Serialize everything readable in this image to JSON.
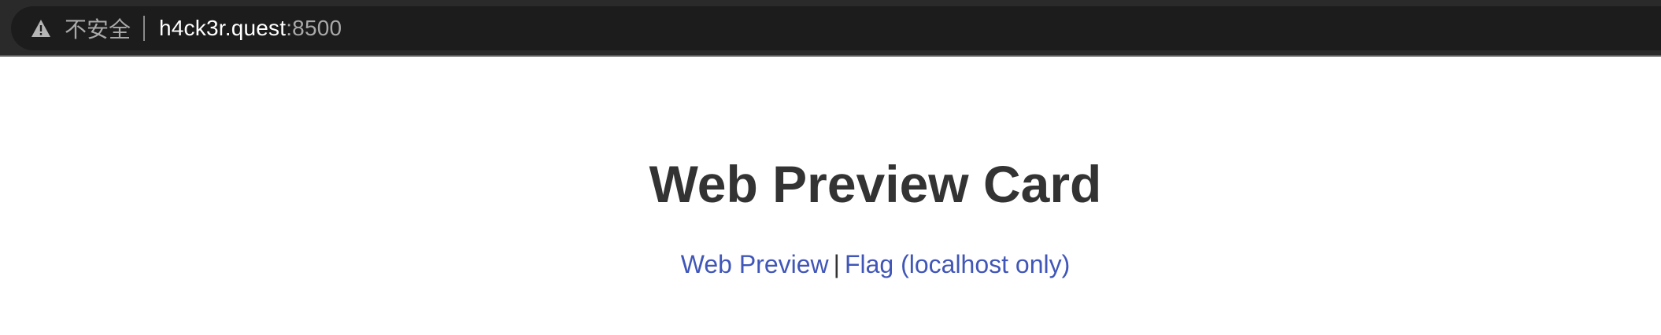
{
  "browser": {
    "security_label": "不安全",
    "url_host": "h4ck3r.quest",
    "url_port": ":8500",
    "warning_icon": "warning-triangle-icon"
  },
  "page": {
    "title": "Web Preview Card",
    "links": [
      {
        "label": "Web Preview"
      },
      {
        "label": "Flag (localhost only)"
      }
    ],
    "separator": "|"
  }
}
